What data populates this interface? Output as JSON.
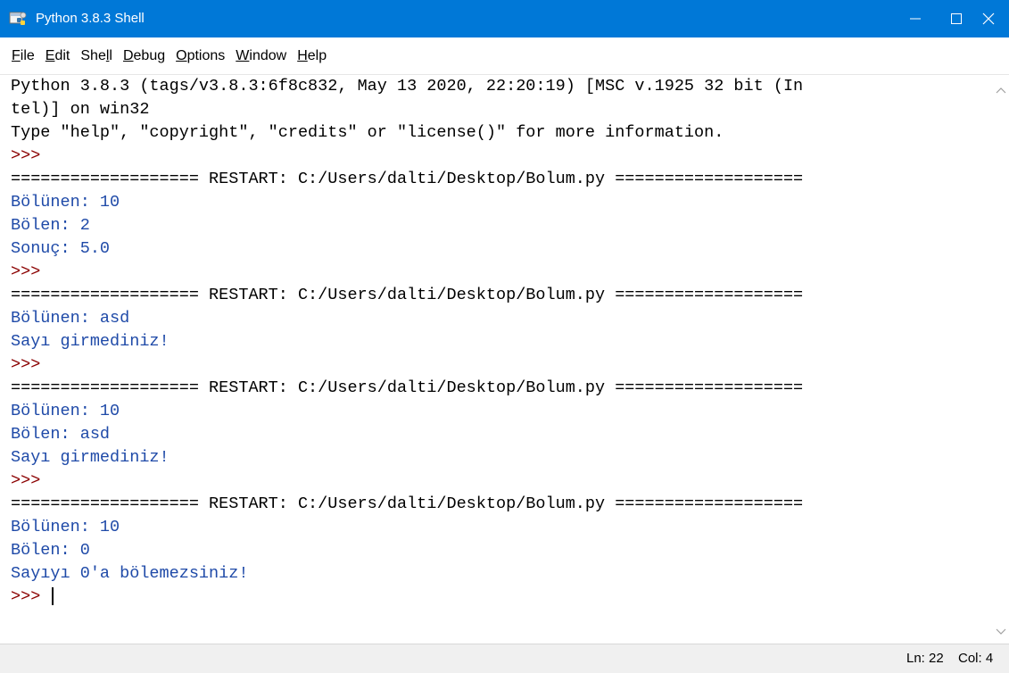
{
  "window": {
    "title": "Python 3.8.3 Shell"
  },
  "menu": {
    "items": [
      {
        "label": "File"
      },
      {
        "label": "Edit"
      },
      {
        "label": "Shell"
      },
      {
        "label": "Debug"
      },
      {
        "label": "Options"
      },
      {
        "label": "Window"
      },
      {
        "label": "Help"
      }
    ]
  },
  "shell": {
    "lines": [
      {
        "text": "Python 3.8.3 (tags/v3.8.3:6f8c832, May 13 2020, 22:20:19) [MSC v.1925 32 bit (In",
        "kind": "default"
      },
      {
        "text": "tel)] on win32",
        "kind": "default"
      },
      {
        "text": "Type \"help\", \"copyright\", \"credits\" or \"license()\" for more information.",
        "kind": "default"
      },
      {
        "text": ">>> ",
        "kind": "prompt"
      },
      {
        "text": "=================== RESTART: C:/Users/dalti/Desktop/Bolum.py ===================",
        "kind": "default"
      },
      {
        "text": "Bölünen: 10",
        "kind": "stdout"
      },
      {
        "text": "Bölen: 2",
        "kind": "stdout"
      },
      {
        "text": "Sonuç: 5.0",
        "kind": "stdout"
      },
      {
        "text": ">>> ",
        "kind": "prompt"
      },
      {
        "text": "=================== RESTART: C:/Users/dalti/Desktop/Bolum.py ===================",
        "kind": "default"
      },
      {
        "text": "Bölünen: asd",
        "kind": "stdout"
      },
      {
        "text": "Sayı girmediniz!",
        "kind": "stdout"
      },
      {
        "text": ">>> ",
        "kind": "prompt"
      },
      {
        "text": "=================== RESTART: C:/Users/dalti/Desktop/Bolum.py ===================",
        "kind": "default"
      },
      {
        "text": "Bölünen: 10",
        "kind": "stdout"
      },
      {
        "text": "Bölen: asd",
        "kind": "stdout"
      },
      {
        "text": "Sayı girmediniz!",
        "kind": "stdout"
      },
      {
        "text": ">>> ",
        "kind": "prompt"
      },
      {
        "text": "=================== RESTART: C:/Users/dalti/Desktop/Bolum.py ===================",
        "kind": "default"
      },
      {
        "text": "Bölünen: 10",
        "kind": "stdout"
      },
      {
        "text": "Bölen: 0",
        "kind": "stdout"
      },
      {
        "text": "Sayıyı 0'a bölemezsiniz!",
        "kind": "stdout"
      },
      {
        "text": ">>> ",
        "kind": "prompt",
        "cursor": true
      }
    ]
  },
  "status": {
    "ln": "Ln: 22",
    "col": "Col: 4"
  },
  "colors": {
    "titlebar": "#0078d7",
    "prompt": "#8b0000",
    "stdout": "#1f4aa8",
    "default": "#000000"
  },
  "icons": {
    "app": "python-idle-icon",
    "minimize": "minimize-icon",
    "maximize": "maximize-icon",
    "close": "close-icon"
  }
}
